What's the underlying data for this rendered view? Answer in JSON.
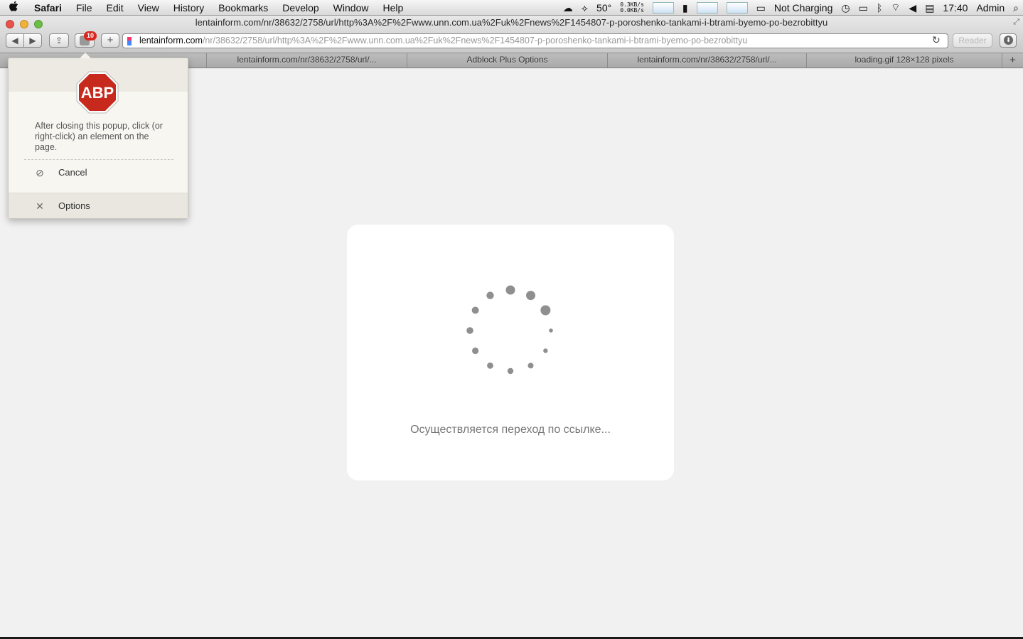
{
  "menubar": {
    "apple": "",
    "items": [
      "Safari",
      "File",
      "Edit",
      "View",
      "History",
      "Bookmarks",
      "Develop",
      "Window",
      "Help"
    ],
    "status": {
      "temperature": "50°",
      "net_up": "0.3KB/s",
      "net_down": "0.0KB/s",
      "battery_text": "Not Charging",
      "clock": "17:40",
      "user": "Admin"
    }
  },
  "window": {
    "title": "lentainform.com/nr/38632/2758/url/http%3A%2F%2Fwww.unn.com.ua%2Fuk%2Fnews%2F1454807-p-poroshenko-tankami-i-btrami-byemo-po-bezrobittyu"
  },
  "toolbar": {
    "back": "◀",
    "forward": "▶",
    "share": "⇪",
    "abp_badge": "10",
    "add": "+",
    "url_host": "lentainform.com",
    "url_path": "/nr/38632/2758/url/http%3A%2F%2Fwww.unn.com.ua%2Fuk%2Fnews%2F1454807-p-poroshenko-tankami-i-btrami-byemo-po-bezrobittyu",
    "reload": "↻",
    "reader": "Reader",
    "downloads": "⬇"
  },
  "tabs": [
    {
      "label": ""
    },
    {
      "label": "lentainform.com/nr/38632/2758/url/..."
    },
    {
      "label": "Adblock Plus Options"
    },
    {
      "label": "lentainform.com/nr/38632/2758/url/..."
    },
    {
      "label": "loading.gif 128×128 pixels"
    }
  ],
  "new_tab": "+",
  "page": {
    "redirect_message": "Осуществляется переход по ссылке..."
  },
  "abp_popup": {
    "logo_text": "ABP",
    "message": "After closing this popup, click (or right-click) an element on the page.",
    "cancel_label": "Cancel",
    "options_label": "Options",
    "cancel_icon": "⊘",
    "options_icon": "✕"
  },
  "colors": {
    "abp_red": "#c7291c",
    "spinner_dot": "#8f8f8f"
  }
}
